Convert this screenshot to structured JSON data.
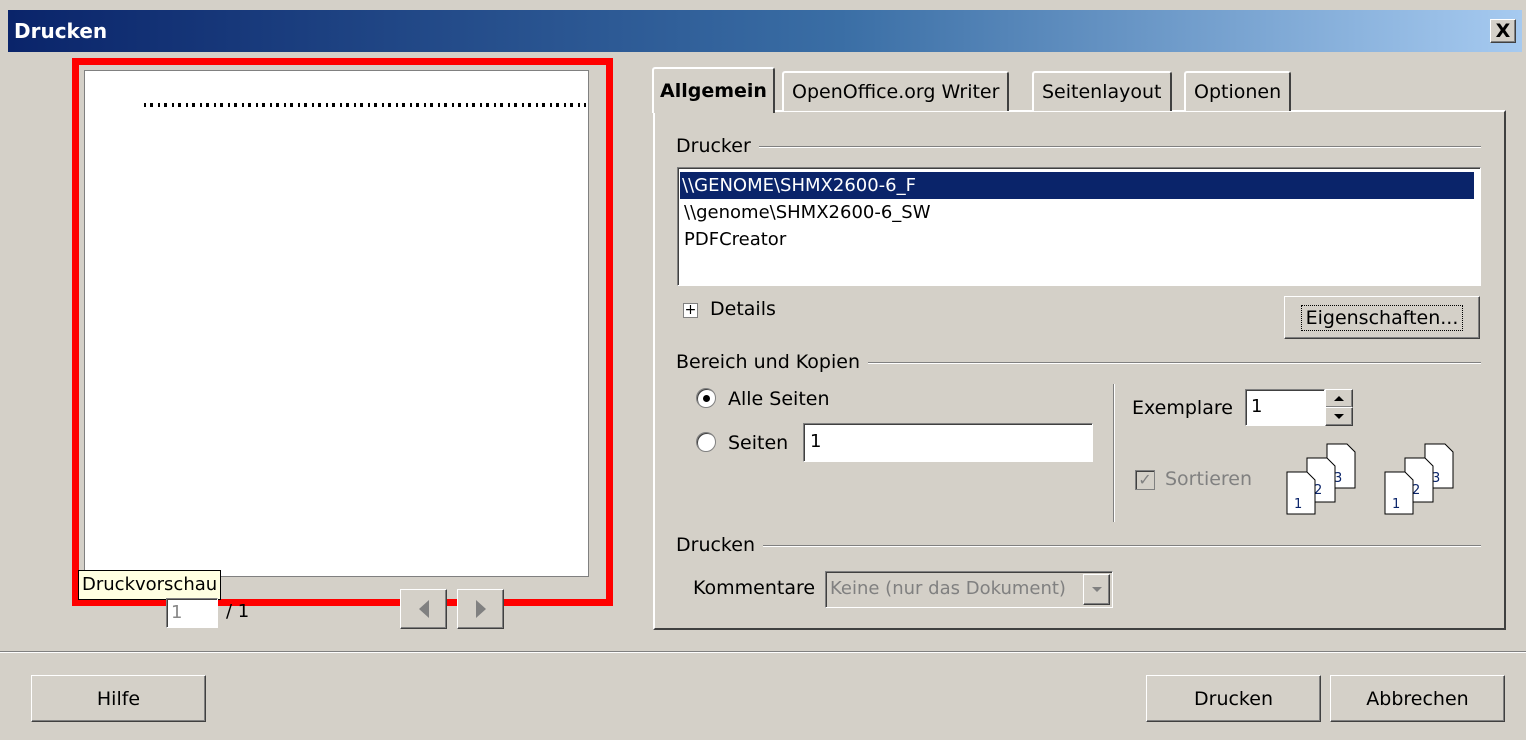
{
  "window": {
    "title": "Drucken",
    "close_glyph": "X"
  },
  "preview": {
    "tooltip": "Druckvorschau",
    "page_input": "1",
    "page_total": "/ 1"
  },
  "tabs": [
    {
      "label": "Allgemein",
      "active": true
    },
    {
      "label": "OpenOffice.org Writer",
      "active": false
    },
    {
      "label": "Seitenlayout",
      "active": false
    },
    {
      "label": "Optionen",
      "active": false
    }
  ],
  "printer_group": {
    "label": "Drucker",
    "printers": [
      {
        "name": "\\\\GENOME\\SHMX2600-6_F",
        "selected": true
      },
      {
        "name": "\\\\genome\\SHMX2600-6_SW",
        "selected": false
      },
      {
        "name": "PDFCreator",
        "selected": false
      }
    ],
    "details_label": "Details",
    "properties_button": "Eigenschaften..."
  },
  "range_group": {
    "label": "Bereich und Kopien",
    "all_pages_label": "Alle Seiten",
    "pages_label": "Seiten",
    "pages_value": "1",
    "copies_label": "Exemplare",
    "copies_value": "1",
    "collate_label": "Sortieren",
    "collate_checked": true,
    "collate_enabled": false
  },
  "print_group": {
    "label": "Drucken",
    "comments_label": "Kommentare",
    "comments_value": "Keine (nur das Dokument)"
  },
  "buttons": {
    "help": "Hilfe",
    "print": "Drucken",
    "cancel": "Abbrechen"
  },
  "colors": {
    "title_gradient_start": "#0a246a",
    "title_gradient_end": "#a6caf0",
    "dialog_bg": "#d4d0c8",
    "selection": "#0a246a",
    "highlight_frame": "#ff0000",
    "tooltip_bg": "#ffffe1"
  }
}
